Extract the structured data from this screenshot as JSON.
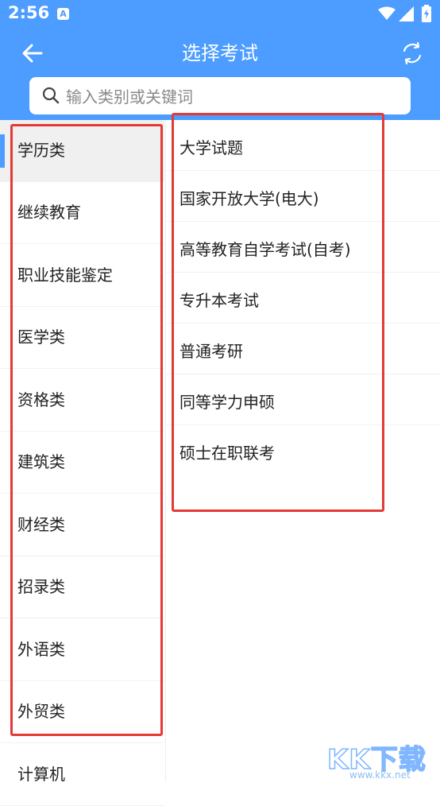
{
  "status_bar": {
    "time": "2:56",
    "app_badge": "A"
  },
  "header": {
    "title": "选择考试",
    "back_icon": "arrow-left-icon",
    "refresh_icon": "refresh-icon",
    "background_color": "#4c9dff"
  },
  "search": {
    "placeholder": "输入类别或关键词",
    "value": ""
  },
  "sidebar": {
    "active_index": 0,
    "items": [
      {
        "label": "学历类"
      },
      {
        "label": "继续教育"
      },
      {
        "label": "职业技能鉴定"
      },
      {
        "label": "医学类"
      },
      {
        "label": "资格类"
      },
      {
        "label": "建筑类"
      },
      {
        "label": "财经类"
      },
      {
        "label": "招录类"
      },
      {
        "label": "外语类"
      },
      {
        "label": "外贸类"
      },
      {
        "label": "计算机"
      }
    ]
  },
  "content": {
    "items": [
      {
        "label": "大学试题"
      },
      {
        "label": "国家开放大学(电大)"
      },
      {
        "label": "高等教育自学考试(自考)"
      },
      {
        "label": "专升本考试"
      },
      {
        "label": "普通考研"
      },
      {
        "label": "同等学力申硕"
      },
      {
        "label": "硕士在职联考"
      }
    ]
  },
  "annotation": {
    "highlight_color": "#e53935"
  },
  "watermark": {
    "logo": "KK下载",
    "url": "www.kkx.net"
  }
}
